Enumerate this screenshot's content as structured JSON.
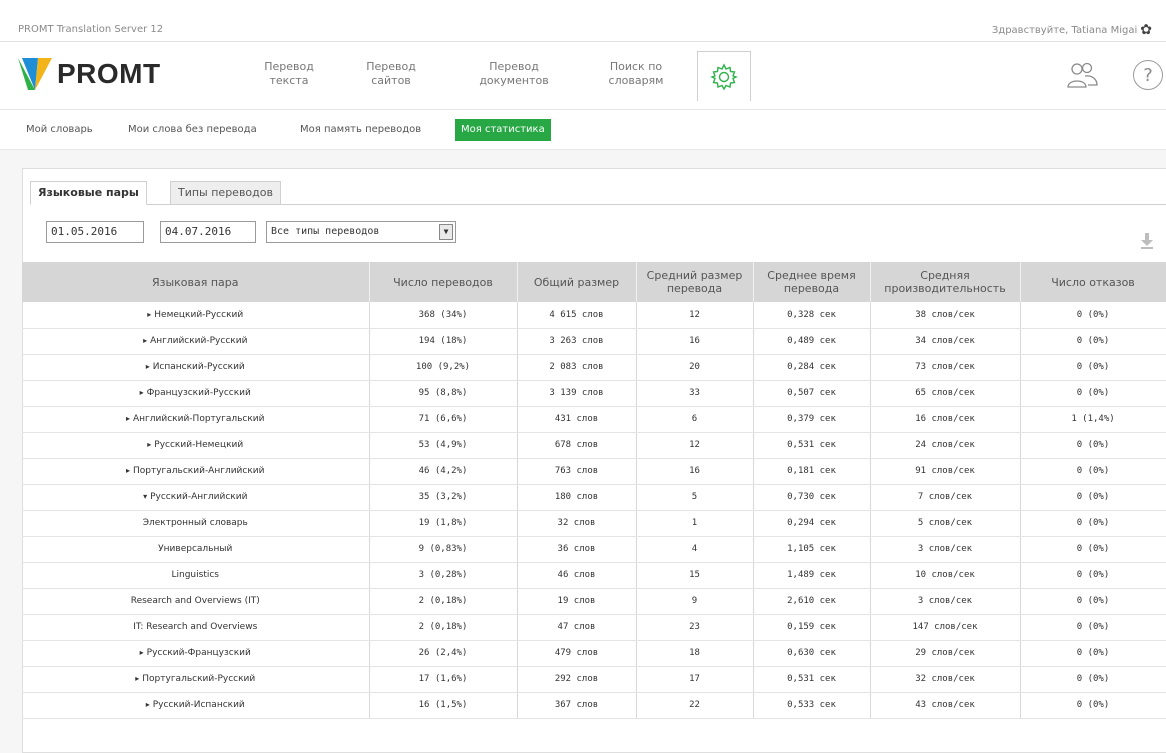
{
  "app": {
    "title": "PROMT Translation Server 12",
    "greeting": "Здравствуйте, Tatiana Migai"
  },
  "logo": {
    "text": "PROMT"
  },
  "nav": {
    "items": [
      {
        "label": "Перевод\nтекста"
      },
      {
        "label": "Перевод\nсайтов"
      },
      {
        "label": "Перевод\nдокументов"
      },
      {
        "label": "Поиск по\nсловарям"
      }
    ]
  },
  "subnav": {
    "items": [
      {
        "label": "Мой словарь"
      },
      {
        "label": "Мои слова без перевода"
      },
      {
        "label": "Моя память переводов"
      },
      {
        "label": "Моя статистика"
      }
    ]
  },
  "tabs": [
    {
      "label": "Языковые пары"
    },
    {
      "label": "Типы переводов"
    }
  ],
  "filters": {
    "date_from": "01.05.2016",
    "date_to": "04.07.2016",
    "type_select": "Все типы переводов"
  },
  "table": {
    "headers": [
      "Языковая пара",
      "Число переводов",
      "Общий размер",
      "Средний размер\nперевода",
      "Среднее время\nперевода",
      "Средняя\nпроизводительность",
      "Число отказов"
    ],
    "rows": [
      {
        "arrow": "▸",
        "pair": "Немецкий-Русский",
        "count": "368 (34%)",
        "size": "4 615 слов",
        "avg_size": "12",
        "avg_time": "0,328 сек",
        "perf": "38 слов/сек",
        "fails": "0 (0%)"
      },
      {
        "arrow": "▸",
        "pair": "Английский-Русский",
        "count": "194 (18%)",
        "size": "3 263 слов",
        "avg_size": "16",
        "avg_time": "0,489 сек",
        "perf": "34 слов/сек",
        "fails": "0 (0%)"
      },
      {
        "arrow": "▸",
        "pair": "Испанский-Русский",
        "count": "100 (9,2%)",
        "size": "2 083 слов",
        "avg_size": "20",
        "avg_time": "0,284 сек",
        "perf": "73 слов/сек",
        "fails": "0 (0%)"
      },
      {
        "arrow": "▸",
        "pair": "Французский-Русский",
        "count": "95 (8,8%)",
        "size": "3 139 слов",
        "avg_size": "33",
        "avg_time": "0,507 сек",
        "perf": "65 слов/сек",
        "fails": "0 (0%)"
      },
      {
        "arrow": "▸",
        "pair": "Английский-Португальский",
        "count": "71 (6,6%)",
        "size": "431 слов",
        "avg_size": "6",
        "avg_time": "0,379 сек",
        "perf": "16 слов/сек",
        "fails": "1 (1,4%)"
      },
      {
        "arrow": "▸",
        "pair": "Русский-Немецкий",
        "count": "53 (4,9%)",
        "size": "678 слов",
        "avg_size": "12",
        "avg_time": "0,531 сек",
        "perf": "24 слов/сек",
        "fails": "0 (0%)"
      },
      {
        "arrow": "▸",
        "pair": "Португальский-Английский",
        "count": "46 (4,2%)",
        "size": "763 слов",
        "avg_size": "16",
        "avg_time": "0,181 сек",
        "perf": "91 слов/сек",
        "fails": "0 (0%)"
      },
      {
        "arrow": "▾",
        "pair": "Русский-Английский",
        "count": "35 (3,2%)",
        "size": "180 слов",
        "avg_size": "5",
        "avg_time": "0,730 сек",
        "perf": "7 слов/сек",
        "fails": "0 (0%)"
      },
      {
        "arrow": "",
        "pair": "Электронный словарь",
        "count": "19 (1,8%)",
        "size": "32 слов",
        "avg_size": "1",
        "avg_time": "0,294 сек",
        "perf": "5 слов/сек",
        "fails": "0 (0%)"
      },
      {
        "arrow": "",
        "pair": "Универсальный",
        "count": "9 (0,83%)",
        "size": "36 слов",
        "avg_size": "4",
        "avg_time": "1,105 сек",
        "perf": "3 слов/сек",
        "fails": "0 (0%)"
      },
      {
        "arrow": "",
        "pair": "Linguistics",
        "count": "3 (0,28%)",
        "size": "46 слов",
        "avg_size": "15",
        "avg_time": "1,489 сек",
        "perf": "10 слов/сек",
        "fails": "0 (0%)"
      },
      {
        "arrow": "",
        "pair": "Research and Overviews (IT)",
        "count": "2 (0,18%)",
        "size": "19 слов",
        "avg_size": "9",
        "avg_time": "2,610 сек",
        "perf": "3 слов/сек",
        "fails": "0 (0%)"
      },
      {
        "arrow": "",
        "pair": "IT: Research and Overviews",
        "count": "2 (0,18%)",
        "size": "47 слов",
        "avg_size": "23",
        "avg_time": "0,159 сек",
        "perf": "147 слов/сек",
        "fails": "0 (0%)"
      },
      {
        "arrow": "▸",
        "pair": "Русский-Французский",
        "count": "26 (2,4%)",
        "size": "479 слов",
        "avg_size": "18",
        "avg_time": "0,630 сек",
        "perf": "29 слов/сек",
        "fails": "0 (0%)"
      },
      {
        "arrow": "▸",
        "pair": "Португальский-Русский",
        "count": "17 (1,6%)",
        "size": "292 слов",
        "avg_size": "17",
        "avg_time": "0,531 сек",
        "perf": "32 слов/сек",
        "fails": "0 (0%)"
      },
      {
        "arrow": "▸",
        "pair": "Русский-Испанский",
        "count": "16 (1,5%)",
        "size": "367 слов",
        "avg_size": "22",
        "avg_time": "0,533 сек",
        "perf": "43 слов/сек",
        "fails": "0 (0%)"
      }
    ]
  }
}
